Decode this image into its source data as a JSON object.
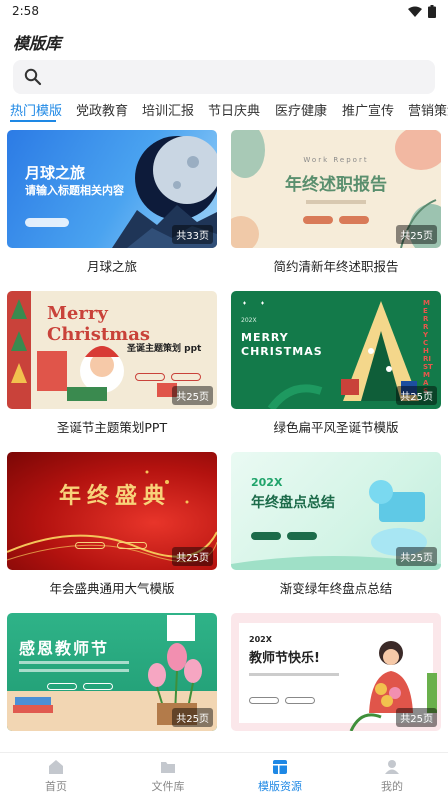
{
  "status": {
    "time": "2:58"
  },
  "app": {
    "title": "模版库"
  },
  "search": {
    "placeholder": ""
  },
  "tabs": [
    {
      "label": "热门模版",
      "active": true
    },
    {
      "label": "党政教育"
    },
    {
      "label": "培训汇报"
    },
    {
      "label": "节日庆典"
    },
    {
      "label": "医疗健康"
    },
    {
      "label": "推广宣传"
    },
    {
      "label": "营销策划"
    }
  ],
  "templates": [
    {
      "title": "月球之旅",
      "pages": "共33页",
      "thumb": {
        "heading": "月球之旅",
        "sub": "请输入标题相关内容"
      }
    },
    {
      "title": "简约清新年终述职报告",
      "pages": "共25页",
      "thumb": {
        "heading": "年终述职报告",
        "top": "Work Report"
      }
    },
    {
      "title": "圣诞节主题策划PPT",
      "pages": "共25页",
      "thumb": {
        "heading": "Merry Christmas",
        "sub": "圣诞主题策划 ppt"
      }
    },
    {
      "title": "绿色扁平风圣诞节模版",
      "pages": "共25页",
      "thumb": {
        "year": "202X",
        "line1": "MERRY",
        "line2": "CHRISTMAS",
        "side": "MERRY CHRISTMAS"
      }
    },
    {
      "title": "年会盛典通用大气模版",
      "pages": "共25页",
      "thumb": {
        "heading": "年终盛典"
      }
    },
    {
      "title": "渐变绿年终盘点总结",
      "pages": "共25页",
      "thumb": {
        "year": "202X",
        "heading": "年终盘点总结"
      }
    },
    {
      "title": "",
      "pages": "共25页",
      "thumb": {
        "heading": "感恩教师节"
      }
    },
    {
      "title": "",
      "pages": "共25页",
      "thumb": {
        "year": "202X",
        "heading": "教师节快乐!"
      }
    }
  ],
  "nav": [
    {
      "label": "首页"
    },
    {
      "label": "文件库"
    },
    {
      "label": "模版资源",
      "active": true
    },
    {
      "label": "我的"
    }
  ],
  "colors": {
    "accent": "#1e88e5"
  }
}
